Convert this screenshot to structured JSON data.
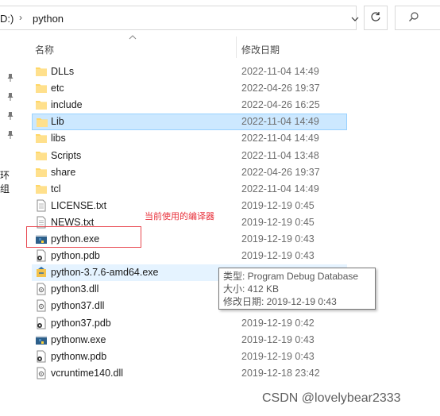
{
  "address_bar": {
    "drive": "D:)",
    "separator": "›",
    "folder": "python",
    "dropdown_icon": "chevron-down-icon",
    "refresh_icon": "refresh-icon",
    "search_icon": "search-icon"
  },
  "nav": {
    "partial_label": "环组",
    "pins": [
      "pin-icon",
      "pin-icon",
      "pin-icon",
      "pin-icon"
    ]
  },
  "header": {
    "name_label": "名称",
    "date_label": "修改日期"
  },
  "files": [
    {
      "name": "DLLs",
      "date": "2022-11-04 14:49",
      "type": "folder"
    },
    {
      "name": "etc",
      "date": "2022-04-26 19:37",
      "type": "folder"
    },
    {
      "name": "include",
      "date": "2022-04-26 16:25",
      "type": "folder"
    },
    {
      "name": "Lib",
      "date": "2022-11-04 14:49",
      "type": "folder",
      "selected": true
    },
    {
      "name": "libs",
      "date": "2022-11-04 14:49",
      "type": "folder"
    },
    {
      "name": "Scripts",
      "date": "2022-11-04 13:48",
      "type": "folder"
    },
    {
      "name": "share",
      "date": "2022-04-26 19:37",
      "type": "folder"
    },
    {
      "name": "tcl",
      "date": "2022-11-04 14:49",
      "type": "folder"
    },
    {
      "name": "LICENSE.txt",
      "date": "2019-12-19 0:45",
      "type": "text"
    },
    {
      "name": "NEWS.txt",
      "date": "2019-12-19 0:45",
      "type": "text"
    },
    {
      "name": "python.exe",
      "date": "2019-12-19 0:43",
      "type": "python-exe"
    },
    {
      "name": "python.pdb",
      "date": "2019-12-19 0:43",
      "type": "pdb"
    },
    {
      "name": "python-3.7.6-amd64.exe",
      "date": "",
      "type": "installer",
      "hovered": true
    },
    {
      "name": "python3.dll",
      "date": "",
      "type": "dll"
    },
    {
      "name": "python37.dll",
      "date": "",
      "type": "dll"
    },
    {
      "name": "python37.pdb",
      "date": "2019-12-19 0:42",
      "type": "pdb"
    },
    {
      "name": "pythonw.exe",
      "date": "2019-12-19 0:43",
      "type": "python-exe"
    },
    {
      "name": "pythonw.pdb",
      "date": "2019-12-19 0:43",
      "type": "pdb"
    },
    {
      "name": "vcruntime140.dll",
      "date": "2019-12-18 23:42",
      "type": "dll"
    }
  ],
  "annotation": {
    "text": "当前使用的编译器",
    "color": "#e8303a"
  },
  "tooltip": {
    "type_line": "类型: Program Debug Database",
    "size_line": "大小: 412 KB",
    "date_line": "修改日期: 2019-12-19 0:43"
  },
  "watermark": "CSDN @lovelybear2333",
  "colors": {
    "selected_bg": "#cce8ff",
    "hover_bg": "#e5f3ff",
    "folder": "#ffd766"
  }
}
